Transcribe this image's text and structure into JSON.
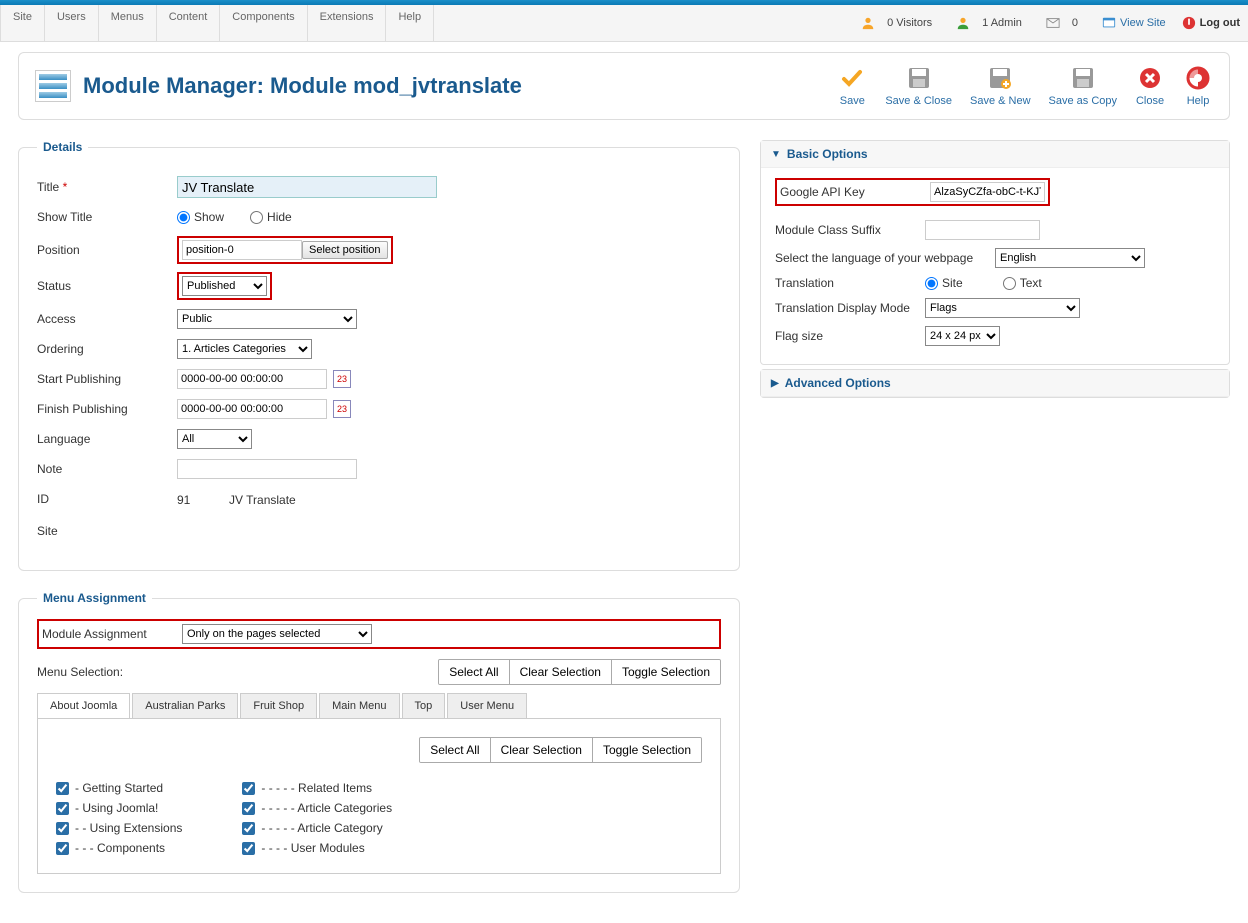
{
  "menu": {
    "items": [
      "Site",
      "Users",
      "Menus",
      "Content",
      "Components",
      "Extensions",
      "Help"
    ]
  },
  "status": {
    "visitors": "0 Visitors",
    "admin": "1 Admin",
    "mail": "0",
    "view_site": "View Site",
    "logout": "Log out"
  },
  "header": {
    "title": "Module Manager: Module mod_jvtranslate"
  },
  "toolbar": {
    "save": "Save",
    "save_close": "Save & Close",
    "save_new": "Save & New",
    "save_copy": "Save as Copy",
    "close": "Close",
    "help": "Help"
  },
  "details": {
    "legend": "Details",
    "labels": {
      "title": "Title",
      "show_title": "Show Title",
      "position": "Position",
      "status": "Status",
      "access": "Access",
      "ordering": "Ordering",
      "start_pub": "Start Publishing",
      "finish_pub": "Finish Publishing",
      "language": "Language",
      "note": "Note",
      "id": "ID",
      "site": "Site"
    },
    "title_value": "JV Translate",
    "show_option": "Show",
    "hide_option": "Hide",
    "position_value": "position-0",
    "select_position_btn": "Select position",
    "status_value": "Published",
    "access_value": "Public",
    "ordering_value": "1. Articles Categories",
    "start_pub_value": "0000-00-00 00:00:00",
    "finish_pub_value": "0000-00-00 00:00:00",
    "language_value": "All",
    "id_value": "91",
    "id_text": "JV Translate"
  },
  "basic": {
    "title": "Basic Options",
    "labels": {
      "api_key": "Google API Key",
      "suffix": "Module Class Suffix",
      "lang_select": "Select the language of your webpage",
      "translation": "Translation",
      "display_mode": "Translation Display Mode",
      "flag_size": "Flag size"
    },
    "api_key_value": "AlzaSyCZfa-obC-t-KJTM",
    "lang_value": "English",
    "translation_site": "Site",
    "translation_text": "Text",
    "display_mode_value": "Flags",
    "flag_size_value": "24 x 24 px"
  },
  "advanced": {
    "title": "Advanced Options"
  },
  "menu_assign": {
    "legend": "Menu Assignment",
    "label": "Module Assignment",
    "value": "Only on the pages selected",
    "menu_selection_label": "Menu Selection:",
    "buttons": {
      "select_all": "Select All",
      "clear": "Clear Selection",
      "toggle": "Toggle Selection"
    },
    "tabs": [
      "About Joomla",
      "Australian Parks",
      "Fruit Shop",
      "Main Menu",
      "Top",
      "User Menu"
    ],
    "left_items": [
      "- Getting Started",
      "- Using Joomla!",
      "- - Using Extensions",
      "- - - Components"
    ],
    "right_items": [
      "- - - - - Related Items",
      "- - - - - Article Categories",
      "- - - - - Article Category",
      "- - - - User Modules"
    ]
  }
}
